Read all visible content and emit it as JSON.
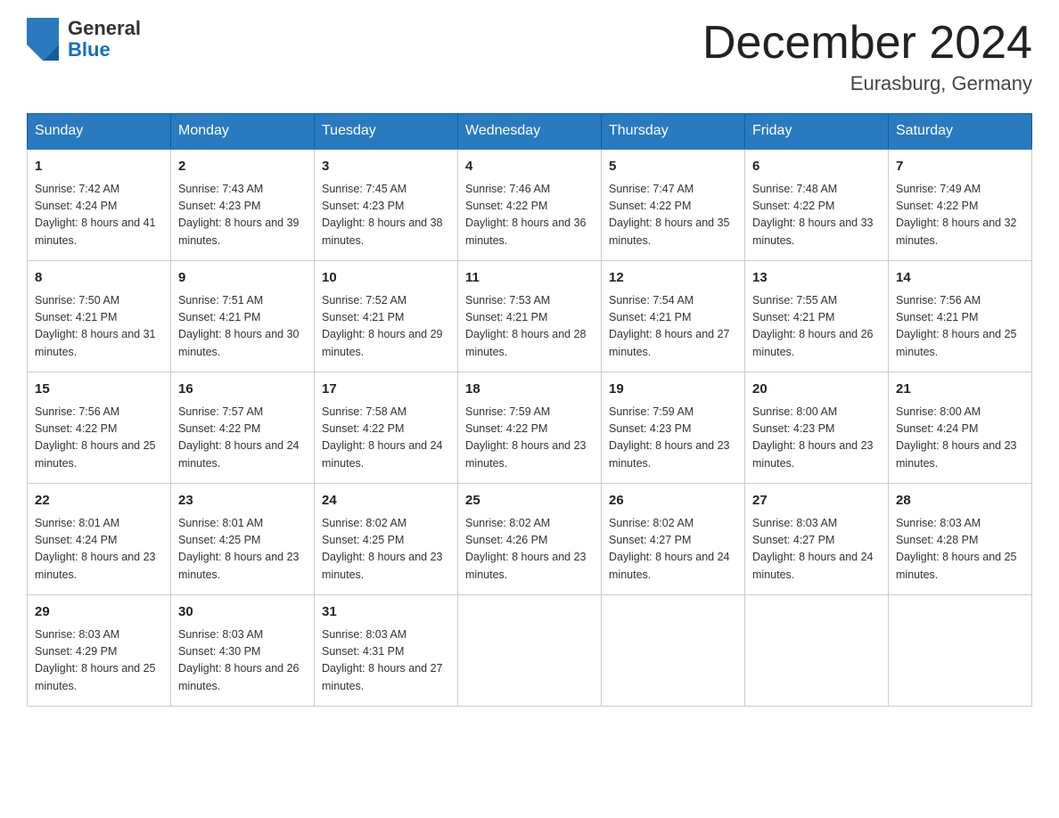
{
  "header": {
    "logo": {
      "text_general": "General",
      "text_blue": "Blue"
    },
    "title": "December 2024",
    "subtitle": "Eurasburg, Germany"
  },
  "calendar": {
    "days_of_week": [
      "Sunday",
      "Monday",
      "Tuesday",
      "Wednesday",
      "Thursday",
      "Friday",
      "Saturday"
    ],
    "weeks": [
      [
        {
          "day": "1",
          "sunrise": "Sunrise: 7:42 AM",
          "sunset": "Sunset: 4:24 PM",
          "daylight": "Daylight: 8 hours and 41 minutes."
        },
        {
          "day": "2",
          "sunrise": "Sunrise: 7:43 AM",
          "sunset": "Sunset: 4:23 PM",
          "daylight": "Daylight: 8 hours and 39 minutes."
        },
        {
          "day": "3",
          "sunrise": "Sunrise: 7:45 AM",
          "sunset": "Sunset: 4:23 PM",
          "daylight": "Daylight: 8 hours and 38 minutes."
        },
        {
          "day": "4",
          "sunrise": "Sunrise: 7:46 AM",
          "sunset": "Sunset: 4:22 PM",
          "daylight": "Daylight: 8 hours and 36 minutes."
        },
        {
          "day": "5",
          "sunrise": "Sunrise: 7:47 AM",
          "sunset": "Sunset: 4:22 PM",
          "daylight": "Daylight: 8 hours and 35 minutes."
        },
        {
          "day": "6",
          "sunrise": "Sunrise: 7:48 AM",
          "sunset": "Sunset: 4:22 PM",
          "daylight": "Daylight: 8 hours and 33 minutes."
        },
        {
          "day": "7",
          "sunrise": "Sunrise: 7:49 AM",
          "sunset": "Sunset: 4:22 PM",
          "daylight": "Daylight: 8 hours and 32 minutes."
        }
      ],
      [
        {
          "day": "8",
          "sunrise": "Sunrise: 7:50 AM",
          "sunset": "Sunset: 4:21 PM",
          "daylight": "Daylight: 8 hours and 31 minutes."
        },
        {
          "day": "9",
          "sunrise": "Sunrise: 7:51 AM",
          "sunset": "Sunset: 4:21 PM",
          "daylight": "Daylight: 8 hours and 30 minutes."
        },
        {
          "day": "10",
          "sunrise": "Sunrise: 7:52 AM",
          "sunset": "Sunset: 4:21 PM",
          "daylight": "Daylight: 8 hours and 29 minutes."
        },
        {
          "day": "11",
          "sunrise": "Sunrise: 7:53 AM",
          "sunset": "Sunset: 4:21 PM",
          "daylight": "Daylight: 8 hours and 28 minutes."
        },
        {
          "day": "12",
          "sunrise": "Sunrise: 7:54 AM",
          "sunset": "Sunset: 4:21 PM",
          "daylight": "Daylight: 8 hours and 27 minutes."
        },
        {
          "day": "13",
          "sunrise": "Sunrise: 7:55 AM",
          "sunset": "Sunset: 4:21 PM",
          "daylight": "Daylight: 8 hours and 26 minutes."
        },
        {
          "day": "14",
          "sunrise": "Sunrise: 7:56 AM",
          "sunset": "Sunset: 4:21 PM",
          "daylight": "Daylight: 8 hours and 25 minutes."
        }
      ],
      [
        {
          "day": "15",
          "sunrise": "Sunrise: 7:56 AM",
          "sunset": "Sunset: 4:22 PM",
          "daylight": "Daylight: 8 hours and 25 minutes."
        },
        {
          "day": "16",
          "sunrise": "Sunrise: 7:57 AM",
          "sunset": "Sunset: 4:22 PM",
          "daylight": "Daylight: 8 hours and 24 minutes."
        },
        {
          "day": "17",
          "sunrise": "Sunrise: 7:58 AM",
          "sunset": "Sunset: 4:22 PM",
          "daylight": "Daylight: 8 hours and 24 minutes."
        },
        {
          "day": "18",
          "sunrise": "Sunrise: 7:59 AM",
          "sunset": "Sunset: 4:22 PM",
          "daylight": "Daylight: 8 hours and 23 minutes."
        },
        {
          "day": "19",
          "sunrise": "Sunrise: 7:59 AM",
          "sunset": "Sunset: 4:23 PM",
          "daylight": "Daylight: 8 hours and 23 minutes."
        },
        {
          "day": "20",
          "sunrise": "Sunrise: 8:00 AM",
          "sunset": "Sunset: 4:23 PM",
          "daylight": "Daylight: 8 hours and 23 minutes."
        },
        {
          "day": "21",
          "sunrise": "Sunrise: 8:00 AM",
          "sunset": "Sunset: 4:24 PM",
          "daylight": "Daylight: 8 hours and 23 minutes."
        }
      ],
      [
        {
          "day": "22",
          "sunrise": "Sunrise: 8:01 AM",
          "sunset": "Sunset: 4:24 PM",
          "daylight": "Daylight: 8 hours and 23 minutes."
        },
        {
          "day": "23",
          "sunrise": "Sunrise: 8:01 AM",
          "sunset": "Sunset: 4:25 PM",
          "daylight": "Daylight: 8 hours and 23 minutes."
        },
        {
          "day": "24",
          "sunrise": "Sunrise: 8:02 AM",
          "sunset": "Sunset: 4:25 PM",
          "daylight": "Daylight: 8 hours and 23 minutes."
        },
        {
          "day": "25",
          "sunrise": "Sunrise: 8:02 AM",
          "sunset": "Sunset: 4:26 PM",
          "daylight": "Daylight: 8 hours and 23 minutes."
        },
        {
          "day": "26",
          "sunrise": "Sunrise: 8:02 AM",
          "sunset": "Sunset: 4:27 PM",
          "daylight": "Daylight: 8 hours and 24 minutes."
        },
        {
          "day": "27",
          "sunrise": "Sunrise: 8:03 AM",
          "sunset": "Sunset: 4:27 PM",
          "daylight": "Daylight: 8 hours and 24 minutes."
        },
        {
          "day": "28",
          "sunrise": "Sunrise: 8:03 AM",
          "sunset": "Sunset: 4:28 PM",
          "daylight": "Daylight: 8 hours and 25 minutes."
        }
      ],
      [
        {
          "day": "29",
          "sunrise": "Sunrise: 8:03 AM",
          "sunset": "Sunset: 4:29 PM",
          "daylight": "Daylight: 8 hours and 25 minutes."
        },
        {
          "day": "30",
          "sunrise": "Sunrise: 8:03 AM",
          "sunset": "Sunset: 4:30 PM",
          "daylight": "Daylight: 8 hours and 26 minutes."
        },
        {
          "day": "31",
          "sunrise": "Sunrise: 8:03 AM",
          "sunset": "Sunset: 4:31 PM",
          "daylight": "Daylight: 8 hours and 27 minutes."
        },
        null,
        null,
        null,
        null
      ]
    ]
  }
}
